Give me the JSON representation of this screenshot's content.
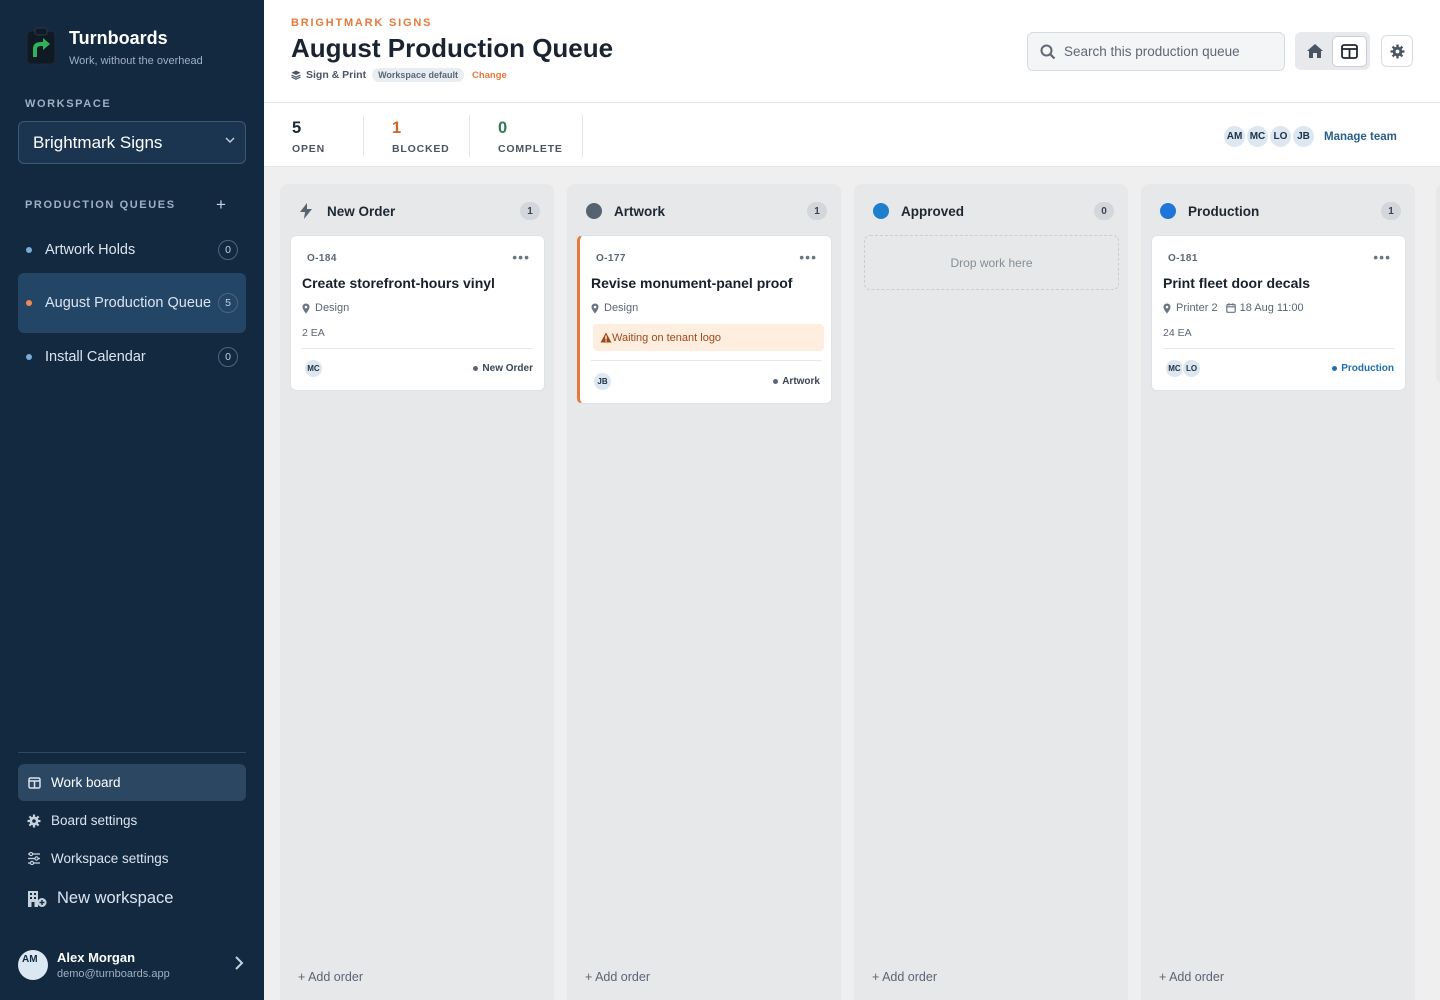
{
  "app": {
    "name": "Turnboards",
    "tagline": "Work, without the overhead"
  },
  "sidebar": {
    "workspace_label": "WORKSPACE",
    "workspace_value": "Brightmark Signs",
    "queues_label": "PRODUCTION QUEUES",
    "queues": [
      {
        "label": "Artwork Holds",
        "count": "0"
      },
      {
        "label": "August Production Queue",
        "count": "5",
        "active": true
      },
      {
        "label": "Install Calendar",
        "count": "0"
      }
    ],
    "nav": {
      "work_board": "Work board",
      "board_settings": "Board settings",
      "workspace_settings": "Workspace settings",
      "new_workspace": "New workspace"
    },
    "user": {
      "initials": "AM",
      "name": "Alex Morgan",
      "email": "demo@turnboards.app"
    }
  },
  "header": {
    "eyebrow": "BRIGHTMARK SIGNS",
    "title": "August Production Queue",
    "template": "Sign & Print",
    "template_tag": "Workspace default",
    "change": "Change",
    "search_placeholder": "Search this production queue"
  },
  "stats": [
    {
      "value": "5",
      "label": "OPEN",
      "color": "#1e2833"
    },
    {
      "value": "1",
      "label": "BLOCKED",
      "color": "#d0662a"
    },
    {
      "value": "0",
      "label": "COMPLETE",
      "color": "#2f7a56"
    }
  ],
  "team": {
    "members": [
      "AM",
      "MC",
      "LO",
      "JB"
    ],
    "manage": "Manage team"
  },
  "board": {
    "add_order": "+ Add order",
    "drop_hint": "Drop work here",
    "columns": [
      {
        "name": "New Order",
        "count": "1",
        "icon": "bolt-icon"
      },
      {
        "name": "Artwork",
        "count": "1",
        "icon_color": "#566471"
      },
      {
        "name": "Approved",
        "count": "0",
        "icon_color": "#1f7fcf"
      },
      {
        "name": "Production",
        "count": "1",
        "icon_color": "#1f75d9"
      }
    ],
    "cards": {
      "o184": {
        "id": "O-184",
        "title": "Create storefront-hours vinyl",
        "location": "Design",
        "qty": "2 EA",
        "assignee": "MC",
        "status": "New Order"
      },
      "o177": {
        "id": "O-177",
        "title": "Revise monument-panel proof",
        "location": "Design",
        "warning": "Waiting on tenant logo",
        "assignee": "JB",
        "status": "Artwork"
      },
      "o181": {
        "id": "O-181",
        "title": "Print fleet door decals",
        "location": "Printer 2",
        "date": "18 Aug 11:00",
        "qty": "24 EA",
        "assignees": [
          "MC",
          "LO"
        ],
        "status": "Production",
        "status_color": "#1f6fb5"
      }
    }
  }
}
